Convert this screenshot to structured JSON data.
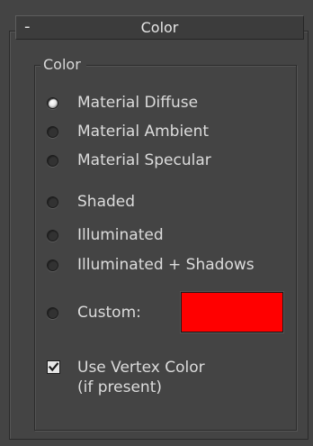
{
  "rollout": {
    "toggle": "-",
    "title": "Color"
  },
  "group": {
    "label": "Color"
  },
  "radios": [
    {
      "label": "Material Diffuse",
      "selected": true
    },
    {
      "label": "Material Ambient",
      "selected": false
    },
    {
      "label": "Material Specular",
      "selected": false
    },
    {
      "label": "Shaded",
      "selected": false
    },
    {
      "label": "Illuminated",
      "selected": false
    },
    {
      "label": "Illuminated + Shadows",
      "selected": false
    },
    {
      "label": "Custom:",
      "selected": false
    }
  ],
  "custom_color": "#ff0000",
  "vertex_color": {
    "label_line1": "Use Vertex Color",
    "label_line2": "(if present)",
    "checked": true
  }
}
